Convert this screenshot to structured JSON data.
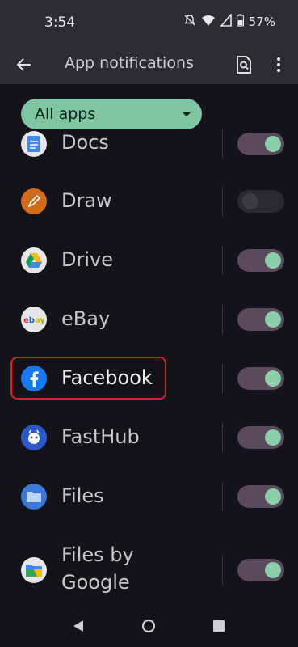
{
  "status_bar": {
    "time": "3:54",
    "battery": "57%"
  },
  "app_bar": {
    "title": "App notifications"
  },
  "filter": {
    "label": "All apps"
  },
  "apps": [
    {
      "name": "Docs",
      "enabled": true,
      "icon": "docs-icon",
      "color": "#4285f4"
    },
    {
      "name": "Draw",
      "enabled": false,
      "icon": "draw-icon",
      "color": "#d36b1d"
    },
    {
      "name": "Drive",
      "enabled": true,
      "icon": "drive-icon",
      "color": "#e7e7ea"
    },
    {
      "name": "eBay",
      "enabled": true,
      "icon": "ebay-icon",
      "color": "#e7e7ea"
    },
    {
      "name": "Facebook",
      "enabled": true,
      "icon": "facebook-icon",
      "color": "#1877f2"
    },
    {
      "name": "FastHub",
      "enabled": true,
      "icon": "fasthub-icon",
      "color": "#2d59c8"
    },
    {
      "name": "Files",
      "enabled": true,
      "icon": "files-icon",
      "color": "#3b78d8"
    },
    {
      "name": "Files by Google",
      "enabled": true,
      "icon": "files-by-google-icon",
      "color": "#e7e7ea"
    }
  ],
  "highlight_color": "#e01b2b",
  "toggle_on_color": "#8bcfab"
}
